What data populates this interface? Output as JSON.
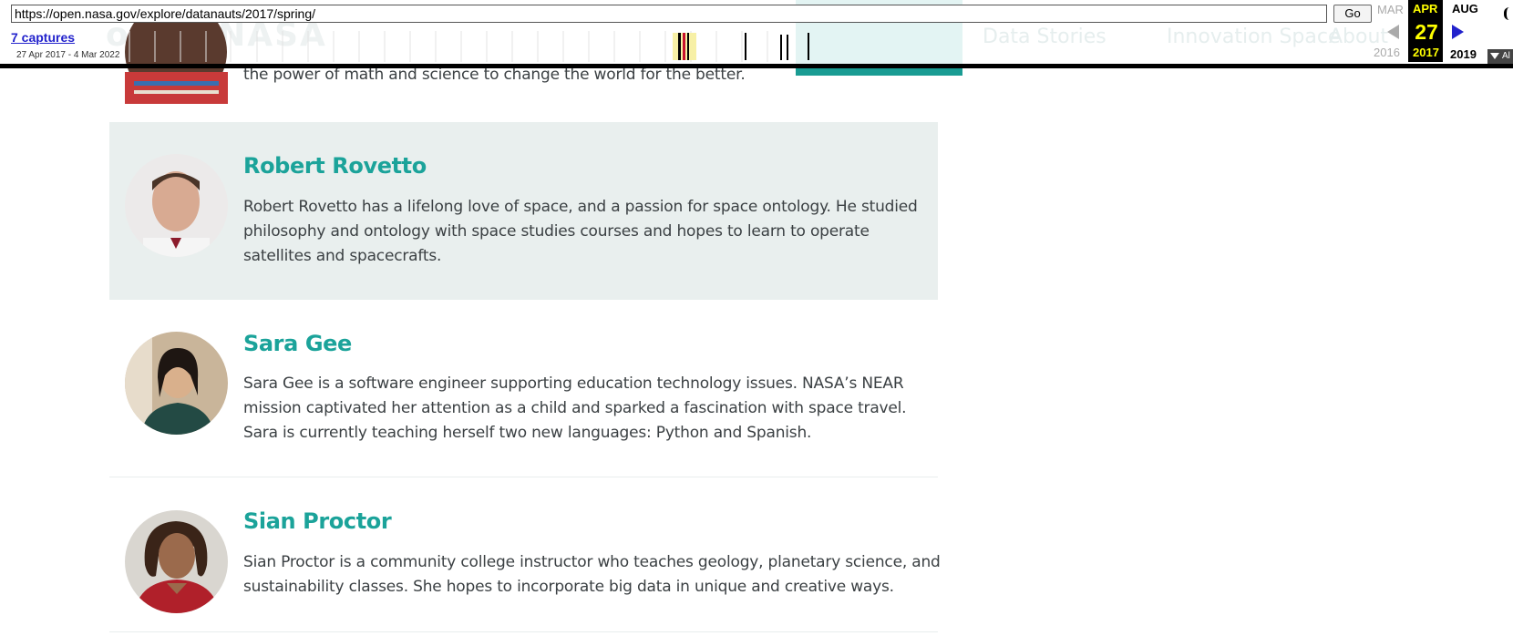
{
  "wayback": {
    "url": "https://open.nasa.gov/explore/datanauts/2017/spring/",
    "go_label": "Go",
    "captures_label": "7 captures",
    "date_range": "27 Apr 2017 - 4 Mar 2022",
    "prev_month": "MAR",
    "current_month": "APR",
    "next_month": "AUG",
    "current_day": "27",
    "prev_year": "2016",
    "current_year": "2017",
    "next_year": "2019",
    "about_label": "Al"
  },
  "site": {
    "logo_ghost": "open NASA",
    "nav_ghost": [
      "Data Stories",
      "Innovation Space",
      "About"
    ]
  },
  "partial_person": {
    "bio_tail": "the power of math and science to change the world for the better."
  },
  "people": [
    {
      "name": "Robert Rovetto",
      "bio": "Robert Rovetto has a lifelong love of space, and a passion for space ontology. He studied philosophy and ontology with space studies courses and hopes to learn to operate satellites and spacecrafts."
    },
    {
      "name": "Sara Gee",
      "bio": "Sara Gee is a software engineer supporting education technology issues. NASA’s NEAR mission captivated her attention as a child and sparked a fascination with space travel. Sara is currently teaching herself two new languages: Python and Spanish."
    },
    {
      "name": "Sian Proctor",
      "bio": "Sian Proctor is a community college instructor who teaches geology, planetary science, and sustainability classes. She hopes to incorporate big data in unique and creative ways."
    }
  ],
  "colors": {
    "accent": "#1ba39a",
    "highlight_bg": "#e9efee",
    "toolbar_current": "#000000",
    "toolbar_current_text": "#ffff00"
  }
}
